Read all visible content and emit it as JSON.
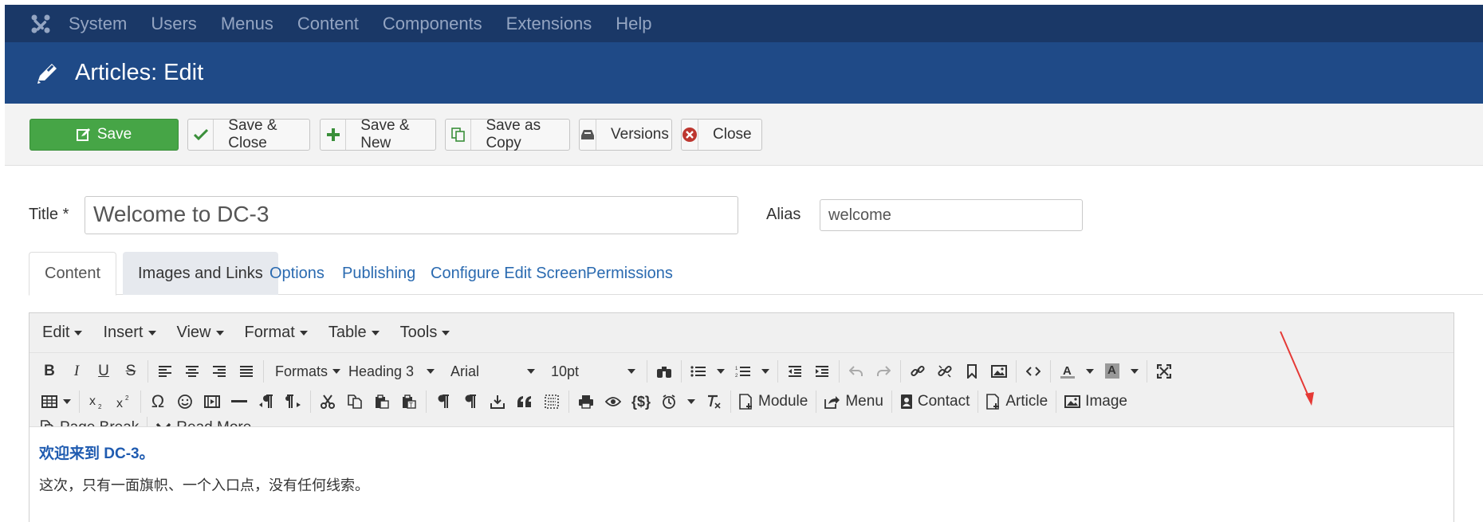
{
  "topnav": {
    "items": [
      "System",
      "Users",
      "Menus",
      "Content",
      "Components",
      "Extensions",
      "Help"
    ]
  },
  "header": {
    "title": "Articles: Edit"
  },
  "toolbar": {
    "save": "Save",
    "save_close": "Save & Close",
    "save_new": "Save & New",
    "save_copy": "Save as Copy",
    "versions": "Versions",
    "close": "Close"
  },
  "form": {
    "title_label": "Title *",
    "title_value": "Welcome to DC-3",
    "alias_label": "Alias",
    "alias_value": "welcome"
  },
  "tabs": [
    "Content",
    "Images and Links",
    "Options",
    "Publishing",
    "Configure Edit Screen",
    "Permissions"
  ],
  "editor": {
    "menus": [
      "Edit",
      "Insert",
      "View",
      "Format",
      "Table",
      "Tools"
    ],
    "formats_label": "Formats",
    "block_format": "Heading 3",
    "font_family": "Arial",
    "font_size": "10pt",
    "buttons": {
      "module": "Module",
      "menu": "Menu",
      "contact": "Contact",
      "article": "Article",
      "image": "Image",
      "page_break": "Page Break",
      "read_more": "Read More"
    },
    "content": {
      "heading": "欢迎来到 DC-3。",
      "paragraph": "这次，只有一面旗帜、一个入口点，没有任何线索。"
    }
  },
  "colors": {
    "topnav_bg": "#1a3867",
    "header_bg": "#1f4a87",
    "save_green": "#46a546",
    "link_blue": "#2a6ab0",
    "annotation_red": "#e53935"
  }
}
